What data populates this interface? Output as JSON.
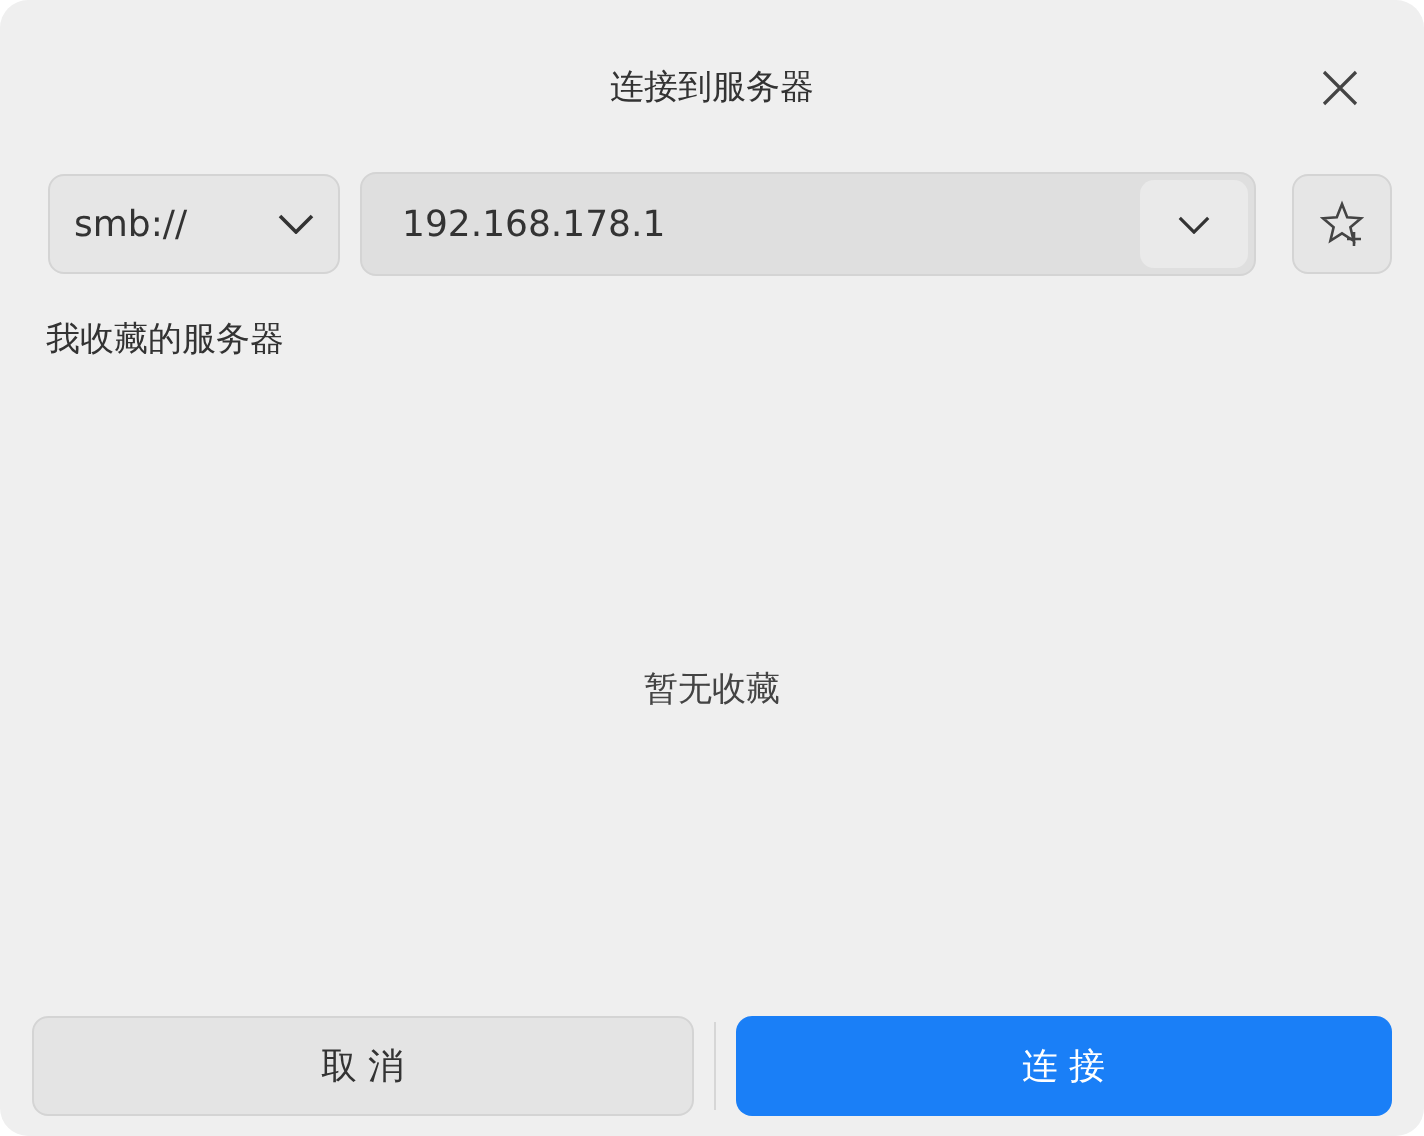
{
  "window": {
    "title": "连接到服务器"
  },
  "protocol": {
    "value": "smb://"
  },
  "address": {
    "value": "192.168.178.1"
  },
  "favorites": {
    "heading": "我收藏的服务器",
    "empty_text": "暂无收藏"
  },
  "buttons": [
    {
      "label": "取 消",
      "kind": "secondary"
    },
    {
      "label": "连 接",
      "kind": "primary"
    }
  ]
}
